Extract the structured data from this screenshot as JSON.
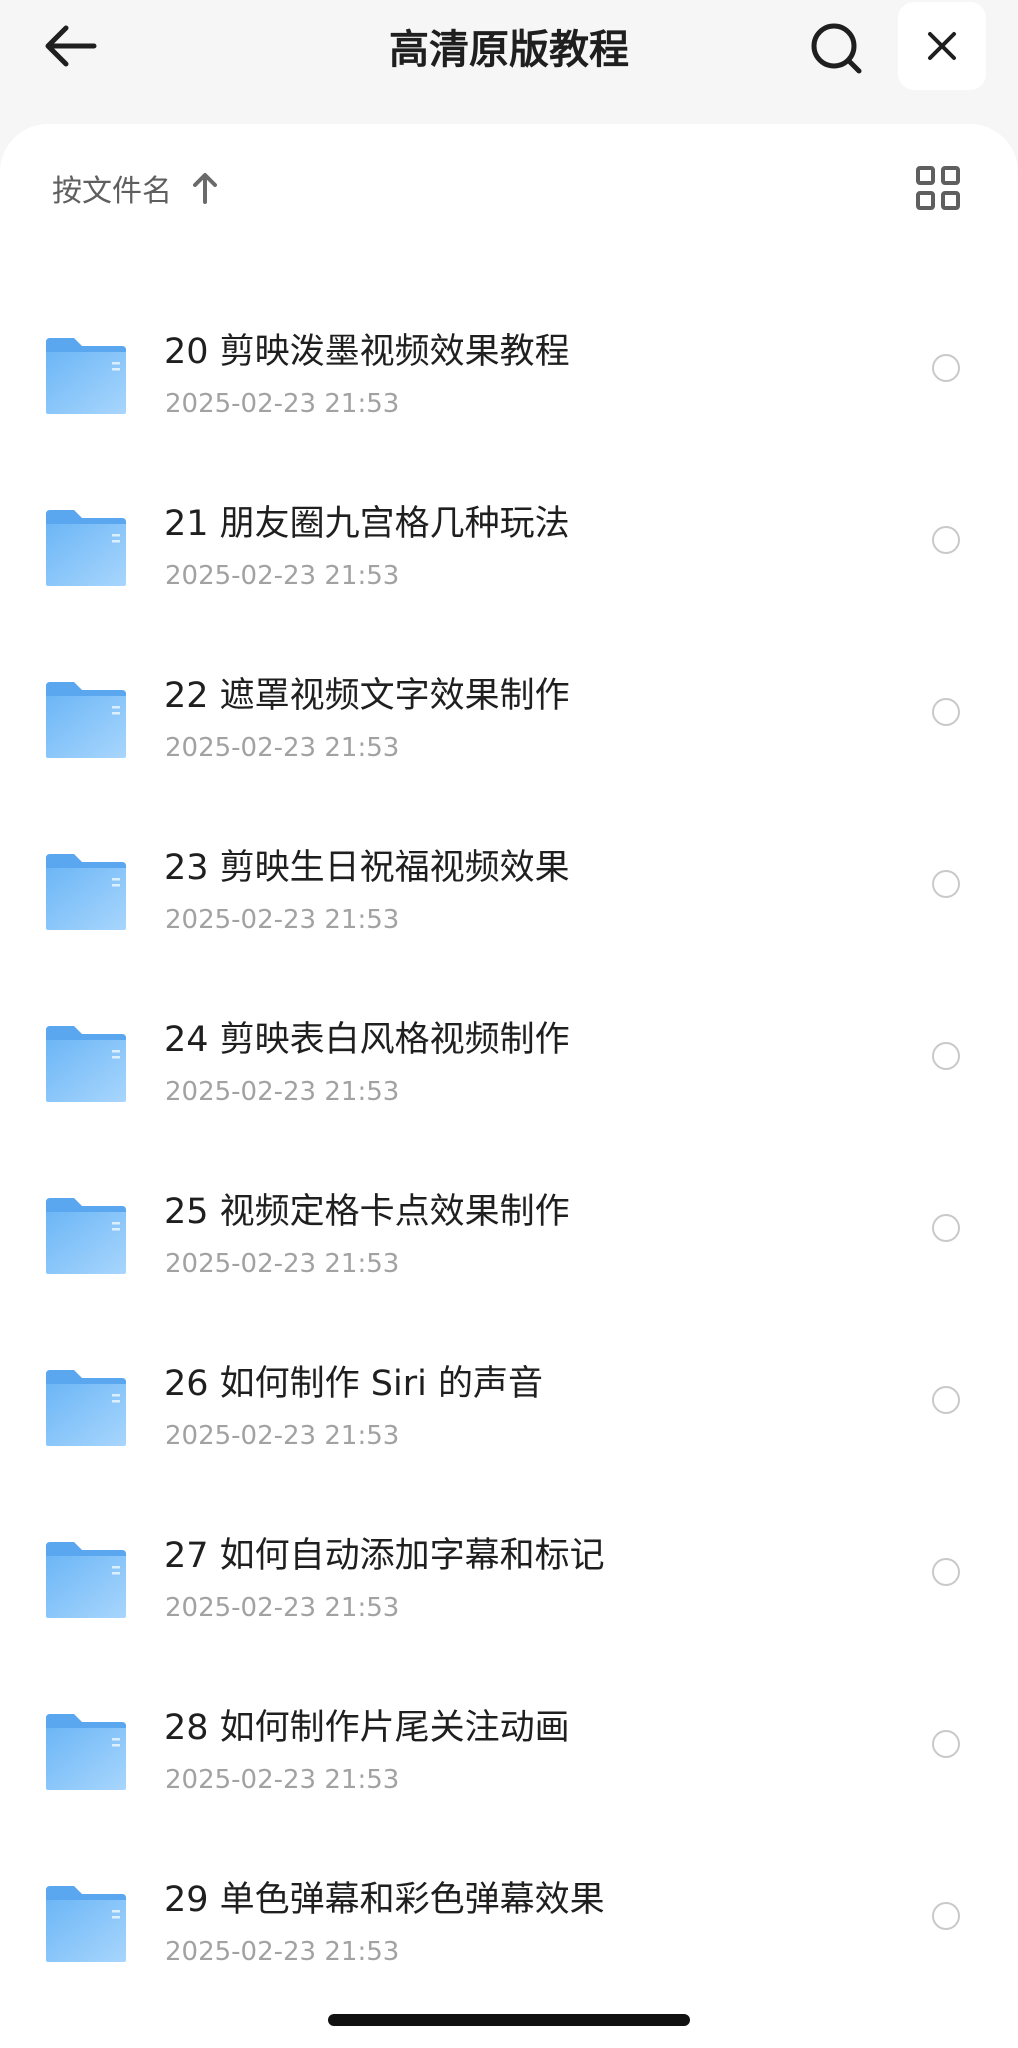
{
  "header": {
    "title": "高清原版教程",
    "back_icon": "arrow-left-icon",
    "search_icon": "search-icon",
    "close_icon": "close-icon"
  },
  "sort": {
    "label": "按文件名",
    "direction_icon": "arrow-up-icon",
    "view_icon": "grid-view-icon"
  },
  "colors": {
    "folder_main": "#7cc0f8",
    "folder_dark": "#5aa7ef",
    "folder_light": "#a8d6fd"
  },
  "files": [
    {
      "name": "20  剪映泼墨视频效果教程",
      "date": "2025-02-23 21:53"
    },
    {
      "name": "21  朋友圈九宫格几种玩法",
      "date": "2025-02-23 21:53"
    },
    {
      "name": "22  遮罩视频文字效果制作",
      "date": "2025-02-23 21:53"
    },
    {
      "name": "23  剪映生日祝福视频效果",
      "date": "2025-02-23 21:53"
    },
    {
      "name": "24  剪映表白风格视频制作",
      "date": "2025-02-23 21:53"
    },
    {
      "name": "25  视频定格卡点效果制作",
      "date": "2025-02-23 21:53"
    },
    {
      "name": "26  如何制作 Siri 的声音",
      "date": "2025-02-23 21:53"
    },
    {
      "name": "27  如何自动添加字幕和标记",
      "date": "2025-02-23 21:53"
    },
    {
      "name": "28  如何制作片尾关注动画",
      "date": "2025-02-23 21:53"
    },
    {
      "name": "29  单色弹幕和彩色弹幕效果",
      "date": "2025-02-23 21:53"
    }
  ]
}
